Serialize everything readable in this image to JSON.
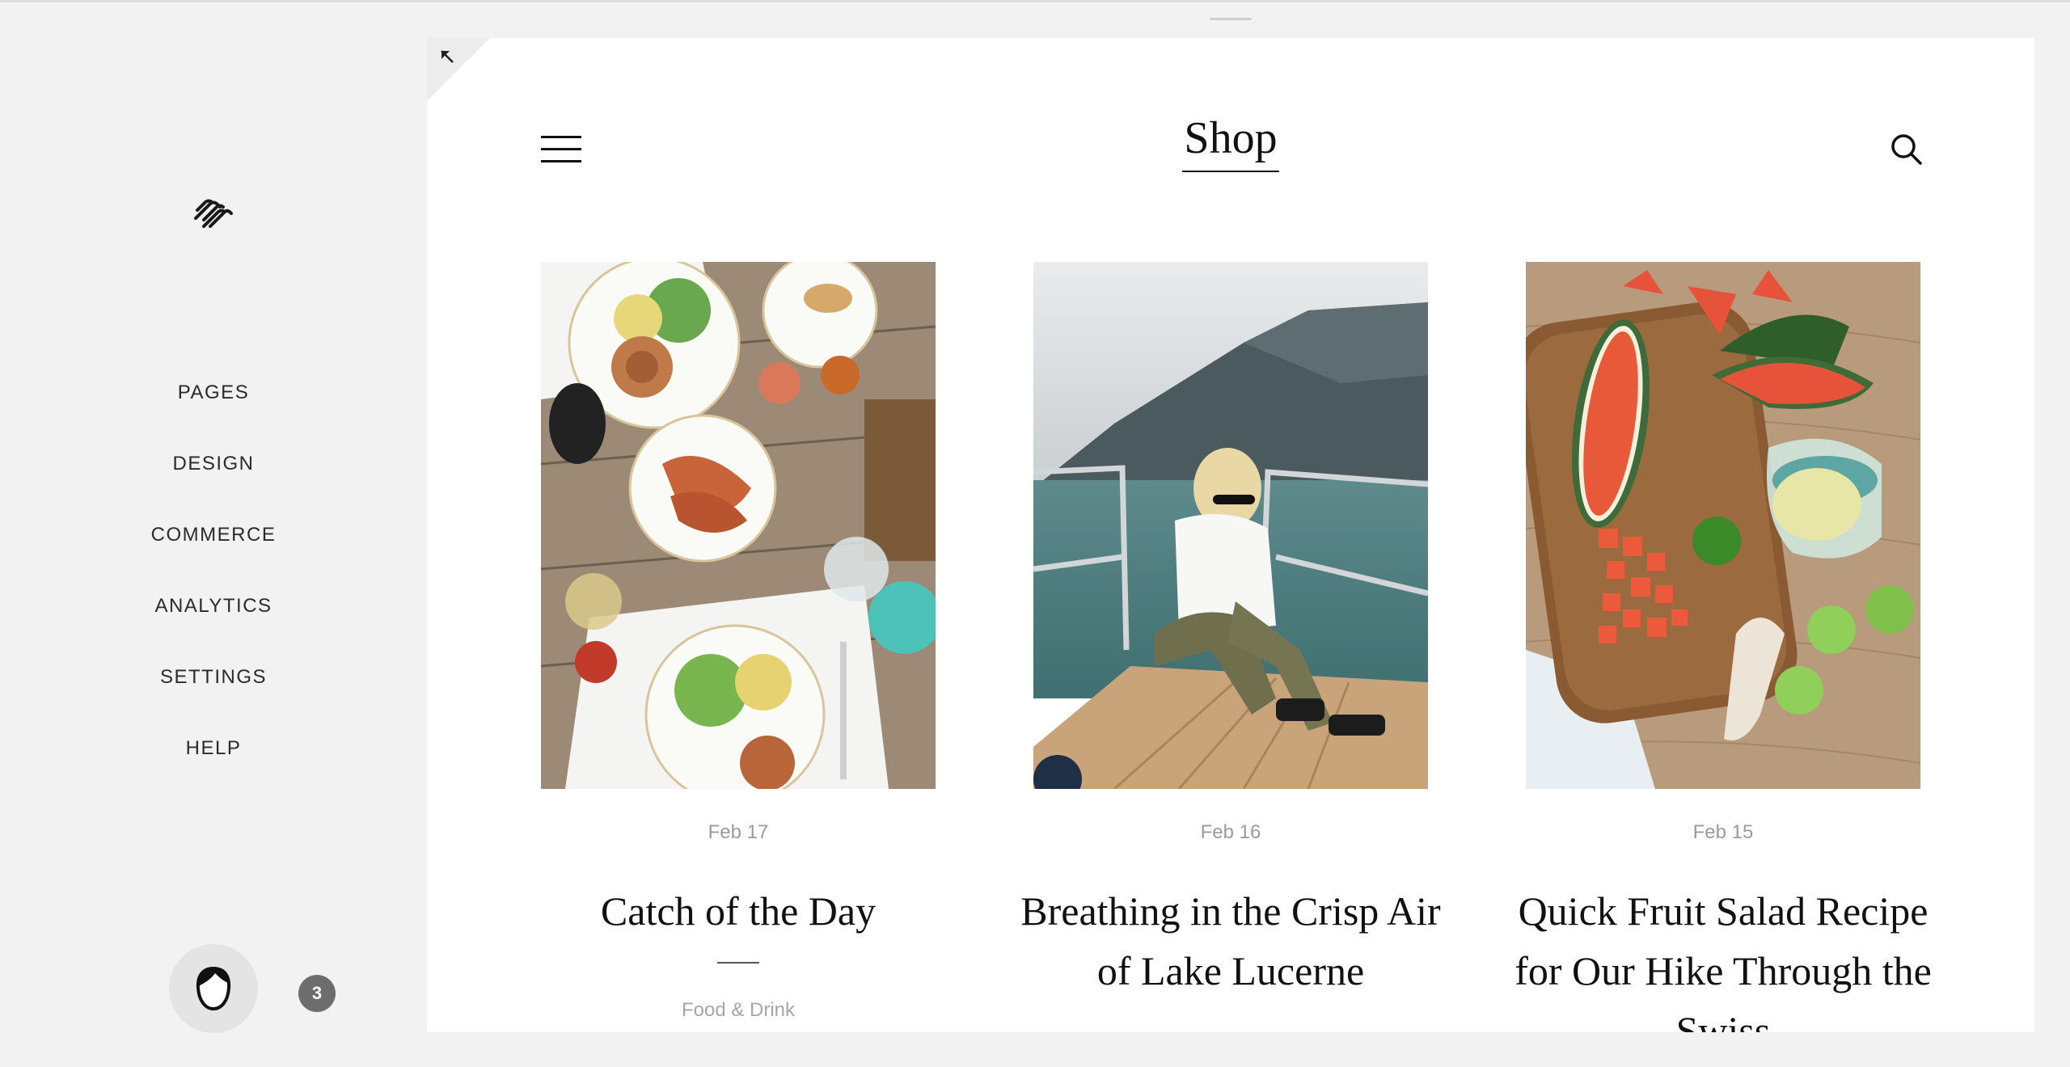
{
  "sidebar": {
    "logo_icon": "squarespace-logo-icon",
    "nav": [
      "PAGES",
      "DESIGN",
      "COMMERCE",
      "ANALYTICS",
      "SETTINGS",
      "HELP"
    ],
    "avatar_icon": "user-avatar-icon",
    "notification_count": "3"
  },
  "preview": {
    "collapse_icon": "arrow-up-left-icon",
    "menu_icon": "hamburger-menu-icon",
    "site_title": "Shop",
    "search_icon": "search-icon"
  },
  "posts": [
    {
      "date": "Feb 17",
      "title": "Catch of the Day",
      "category": "Food & Drink",
      "image": "overhead table with grilled prawns, sausages and salads"
    },
    {
      "date": "Feb 16",
      "title": "Breathing in the Crisp Air of Lake Lucerne",
      "image": "woman in sunglasses sitting on boat deck with lake and mountains"
    },
    {
      "date": "Feb 15",
      "title": "Quick Fruit Salad Recipe for Our Hike Through the Swiss",
      "image": "cutting board with watermelon, limes and lemonade jug"
    }
  ]
}
